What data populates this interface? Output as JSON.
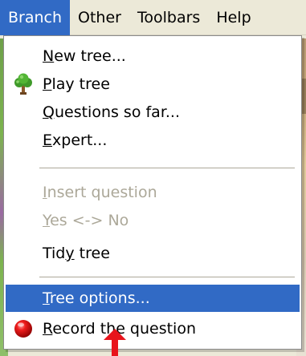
{
  "menubar": {
    "items": [
      {
        "label": "Branch",
        "active": true
      },
      {
        "label": "Other",
        "active": false
      },
      {
        "label": "Toolbars",
        "active": false
      },
      {
        "label": "Help",
        "active": false
      }
    ]
  },
  "menu": {
    "new_tree": {
      "pre": "",
      "mnemonic": "N",
      "post": "ew tree..."
    },
    "play_tree": {
      "pre": "",
      "mnemonic": "P",
      "post": "lay tree",
      "icon": "tree-icon"
    },
    "questions_so_far": {
      "pre": "",
      "mnemonic": "Q",
      "post": "uestions so far..."
    },
    "expert": {
      "pre": "",
      "mnemonic": "E",
      "post": "xpert..."
    },
    "insert_question": {
      "pre": "",
      "mnemonic": "I",
      "post": "nsert question",
      "disabled": true
    },
    "yes_no": {
      "pre": "",
      "mnemonic": "Y",
      "post": "es <-> No",
      "disabled": true
    },
    "tidy_tree": {
      "pre": "Tid",
      "mnemonic": "y",
      "post": " tree"
    },
    "tree_options": {
      "pre": "",
      "mnemonic": "T",
      "post": "ree options...",
      "highlighted": true
    },
    "record_question": {
      "pre": "",
      "mnemonic": "R",
      "post": "ecord the question",
      "icon": "record-icon"
    }
  },
  "colors": {
    "highlight": "#316ac5",
    "disabled_text": "#aca899",
    "arrow": "#e8141c"
  }
}
